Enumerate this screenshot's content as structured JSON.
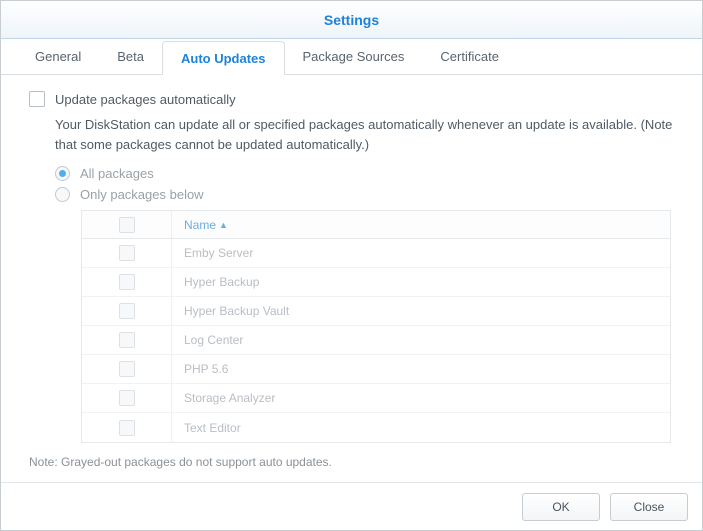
{
  "window": {
    "title": "Settings"
  },
  "tabs": [
    {
      "label": "General",
      "active": false
    },
    {
      "label": "Beta",
      "active": false
    },
    {
      "label": "Auto Updates",
      "active": true
    },
    {
      "label": "Package Sources",
      "active": false
    },
    {
      "label": "Certificate",
      "active": false
    }
  ],
  "auto_updates": {
    "master_label": "Update packages automatically",
    "master_checked": false,
    "description": "Your DiskStation can update all or specified packages automatically whenever an update is available. (Note that some packages cannot be updated automatically.)",
    "radios": {
      "all_label": "All packages",
      "only_label": "Only packages below",
      "selected": "all"
    },
    "table": {
      "header_name": "Name",
      "rows": [
        {
          "name": "Emby Server",
          "checked": false
        },
        {
          "name": "Hyper Backup",
          "checked": false
        },
        {
          "name": "Hyper Backup Vault",
          "checked": false
        },
        {
          "name": "Log Center",
          "checked": false
        },
        {
          "name": "PHP 5.6",
          "checked": false
        },
        {
          "name": "Storage Analyzer",
          "checked": false
        },
        {
          "name": "Text Editor",
          "checked": false
        }
      ]
    },
    "note": "Note: Grayed-out packages do not support auto updates."
  },
  "buttons": {
    "ok": "OK",
    "close": "Close"
  }
}
